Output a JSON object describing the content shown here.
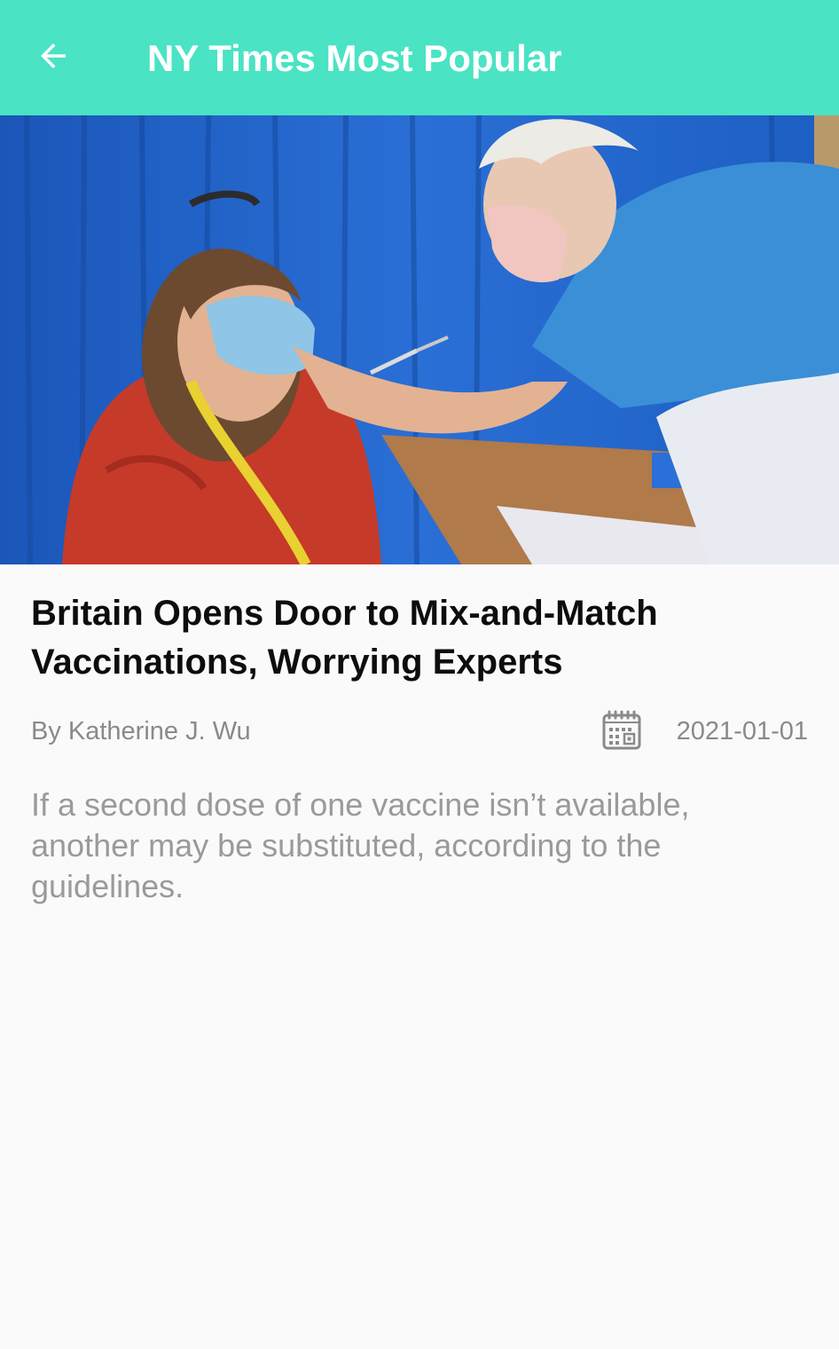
{
  "colors": {
    "app_bar": "#4ae3c4",
    "background": "#fafafa",
    "headline": "#0d0d0d",
    "meta_text": "#8a8a8a",
    "abstract_text": "#9a9a9a"
  },
  "app_bar": {
    "back_icon": "arrow-left-icon",
    "title": "NY Times Most Popular"
  },
  "article": {
    "title": "Britain Opens Door to Mix-and-Match Vaccinations, Worrying Experts",
    "byline": "By Katherine J. Wu",
    "date_icon": "calendar-icon",
    "published_date": "2021-01-01",
    "abstract": "If a second dose of one vaccine isn’t available, another may be substituted, according to the guidelines."
  }
}
